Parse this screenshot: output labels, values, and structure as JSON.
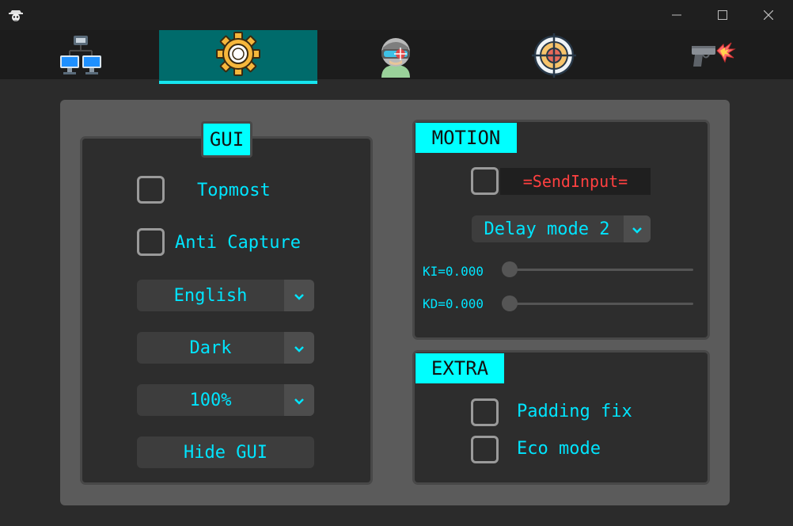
{
  "window": {
    "app_icon": "cowboy-skull-icon",
    "controls": [
      "minimize-icon",
      "maximize-icon",
      "close-icon"
    ]
  },
  "tabs": [
    {
      "name": "tab-network",
      "icon": "network-computers-icon",
      "active": false
    },
    {
      "name": "tab-settings",
      "icon": "gear-icon",
      "active": true
    },
    {
      "name": "tab-aim",
      "icon": "soldier-visor-icon",
      "active": false
    },
    {
      "name": "tab-target",
      "icon": "crosshair-icon",
      "active": false
    },
    {
      "name": "tab-trigger",
      "icon": "pistol-fire-icon",
      "active": false
    }
  ],
  "gui_group": {
    "title": "GUI",
    "topmost_label": "Topmost",
    "anti_capture_label": "Anti Capture",
    "language_value": "English",
    "theme_value": "Dark",
    "scale_value": "100%",
    "hide_gui_label": "Hide GUI"
  },
  "motion_group": {
    "title": "MOTION",
    "send_input_label": "=SendInput=",
    "delay_mode_value": "Delay mode 2",
    "ki_label": "KI=0.000",
    "kd_label": "KD=0.000",
    "ki_value": 0.0,
    "kd_value": 0.0
  },
  "extra_group": {
    "title": "EXTRA",
    "padding_fix_label": "Padding fix",
    "eco_mode_label": "Eco mode"
  },
  "colors": {
    "accent": "#00ffff",
    "text": "#00e5ff",
    "active_tab": "#006b6b",
    "send_input_text": "#ff4040"
  }
}
